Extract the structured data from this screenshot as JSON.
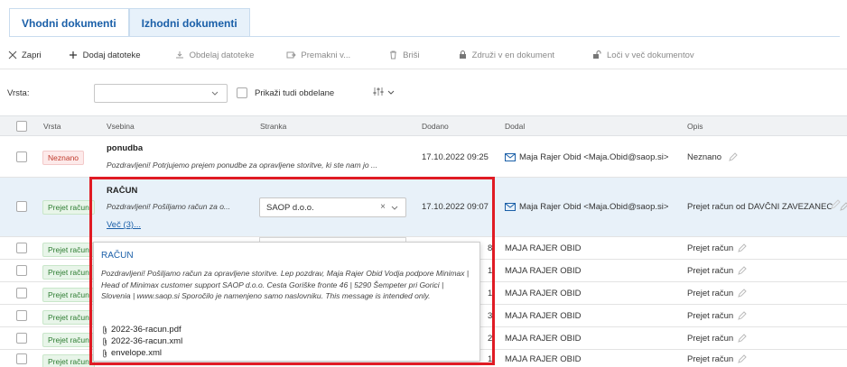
{
  "tabs": [
    {
      "label": "Vhodni dokumenti",
      "active": true
    },
    {
      "label": "Izhodni dokumenti",
      "active": false
    }
  ],
  "toolbar": {
    "close_label": "Zapri",
    "add_files_label": "Dodaj datoteke",
    "process_files_label": "Obdelaj datoteke",
    "move_label": "Premakni v...",
    "delete_label": "Briši",
    "merge_label": "Združi v en dokument",
    "split_label": "Loči v več dokumentov"
  },
  "filter": {
    "type_label": "Vrsta:",
    "type_value": "",
    "show_processed_label": "Prikaži tudi obdelane",
    "show_processed_checked": false
  },
  "table": {
    "headers": {
      "type": "Vrsta",
      "content": "Vsebina",
      "party": "Stranka",
      "added": "Dodano",
      "added_by": "Dodal",
      "description": "Opis"
    },
    "rows": [
      {
        "type": "Neznano",
        "title": "ponudba",
        "body": "Pozdravljeni! Potrjujemo prejem ponudbe za opravljene storitve, ki ste nam jo ...",
        "added": "17.10.2022 09:25",
        "added_by": "Maja Rajer Obid <Maja.Obid@saop.si>",
        "description": "Neznano"
      },
      {
        "type": "Prejet račun",
        "title": "RAČUN",
        "body": "Pozdravljeni! Pošiljamo račun za o...",
        "more": "Več (3)...",
        "party": "SAOP d.o.o.",
        "added": "17.10.2022 09:07",
        "added_by": "Maja Rajer Obid <Maja.Obid@saop.si>",
        "description": "Prejet račun od DAVČNI ZAVEZANEC"
      },
      {
        "type": "Prejet račun",
        "added_tail": "8",
        "added_by": "MAJA RAJER OBID",
        "description": "Prejet račun"
      },
      {
        "type": "Prejet račun",
        "added_tail": "1",
        "added_by": "MAJA RAJER OBID",
        "description": "Prejet račun"
      },
      {
        "type": "Prejet račun",
        "added_tail": "1",
        "added_by": "MAJA RAJER OBID",
        "description": "Prejet račun"
      },
      {
        "type": "Prejet račun",
        "added_tail": "3",
        "added_by": "MAJA RAJER OBID",
        "description": "Prejet račun"
      },
      {
        "type": "Prejet račun",
        "added_tail": "2",
        "added_by": "MAJA RAJER OBID",
        "description": "Prejet račun"
      },
      {
        "type": "Prejet račun",
        "added_tail": "1",
        "added_by": "MAJA RAJER OBID",
        "description": "Prejet račun"
      }
    ]
  },
  "popup": {
    "title": "RAČUN",
    "body": "Pozdravljeni! Pošiljamo račun za opravljene storitve. Lep pozdrav, Maja Rajer Obid Vodja podpore Minimax | Head of Minimax customer support SAOP d.o.o. Cesta Goriške fronte 46 | 5290 Šempeter pri Gorici | Slovenia | www.saop.si Sporočilo je namenjeno samo naslovniku. This message is intended only.",
    "attachments": [
      "2022-36-racun.pdf",
      "2022-36-racun.xml",
      "envelope.xml"
    ]
  },
  "colors": {
    "accent": "#1a5fa8",
    "highlight": "#e01b24",
    "badge_unknown": "#c0392b",
    "badge_invoice": "#2e7d32",
    "selected_row": "#e8f1f9"
  }
}
